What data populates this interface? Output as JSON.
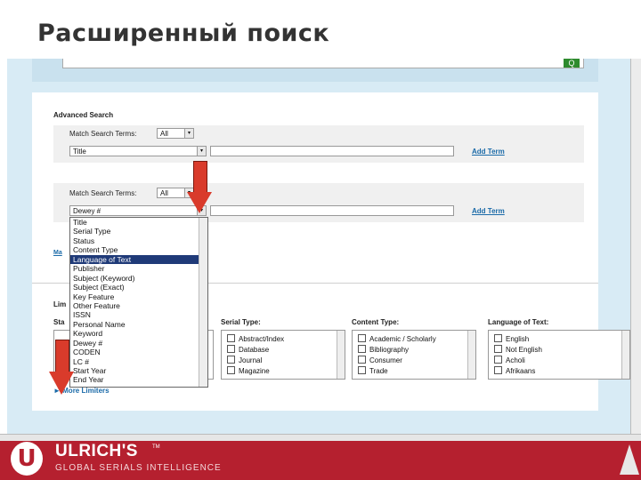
{
  "slide_title": "Расширенный поиск",
  "advanced_search": {
    "heading": "Advanced Search",
    "rows": [
      {
        "match_label": "Match Search Terms:",
        "match_value": "All",
        "field_value": "Title",
        "add_label": "Add Term"
      },
      {
        "match_label": "Match Search Terms:",
        "match_value": "All",
        "field_value": "Dewey #",
        "add_label": "Add Term"
      }
    ],
    "dropdown_options": [
      "Title",
      "Serial Type",
      "Status",
      "Content Type",
      "Language of Text",
      "Publisher",
      "Subject (Keyword)",
      "Subject (Exact)",
      "Key Feature",
      "Other Feature",
      "ISSN",
      "Personal Name",
      "Keyword",
      "Dewey #",
      "CODEN",
      "LC #",
      "Start Year",
      "End Year"
    ],
    "dropdown_selected": "Language of Text",
    "partial_ma": "Ma",
    "partial_lim": "Lim",
    "partial_sta": "Sta"
  },
  "limiters": {
    "serial_type": {
      "heading": "Serial Type:",
      "items": [
        "Abstract/Index",
        "Database",
        "Journal",
        "Magazine"
      ]
    },
    "content_type": {
      "heading": "Content Type:",
      "items": [
        "Academic / Scholarly",
        "Bibliography",
        "Consumer",
        "Trade"
      ]
    },
    "language": {
      "heading": "Language of Text:",
      "items": [
        "English",
        "Not English",
        "Acholi",
        "Afrikaans"
      ]
    },
    "more_limiters": "► More Limiters"
  },
  "footer": {
    "brand": "ULRICH'S",
    "tm": "TM",
    "tagline": "GLOBAL SERIALS INTELLIGENCE",
    "logo_letter": "U",
    "color": "#b5202f"
  },
  "top_button": "Q"
}
